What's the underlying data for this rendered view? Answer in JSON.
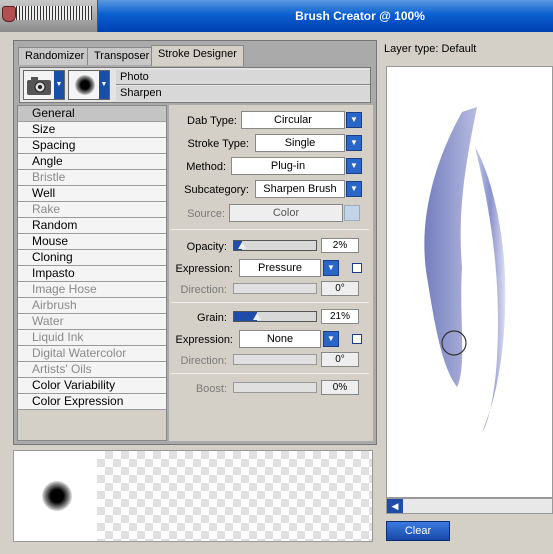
{
  "window": {
    "title": "Brush Creator @ 100%"
  },
  "tabs": [
    {
      "label": "Randomizer"
    },
    {
      "label": "Transposer"
    },
    {
      "label": "Stroke Designer",
      "active": true
    }
  ],
  "brush": {
    "category": "Photo",
    "variant": "Sharpen"
  },
  "categories": [
    {
      "label": "General",
      "selected": true,
      "enabled": true
    },
    {
      "label": "Size",
      "enabled": true
    },
    {
      "label": "Spacing",
      "enabled": true
    },
    {
      "label": "Angle",
      "enabled": true
    },
    {
      "label": "Bristle",
      "enabled": false
    },
    {
      "label": "Well",
      "enabled": true
    },
    {
      "label": "Rake",
      "enabled": false
    },
    {
      "label": "Random",
      "enabled": true
    },
    {
      "label": "Mouse",
      "enabled": true
    },
    {
      "label": "Cloning",
      "enabled": true
    },
    {
      "label": "Impasto",
      "enabled": true
    },
    {
      "label": "Image Hose",
      "enabled": false
    },
    {
      "label": "Airbrush",
      "enabled": false
    },
    {
      "label": "Water",
      "enabled": false
    },
    {
      "label": "Liquid Ink",
      "enabled": false
    },
    {
      "label": "Digital Watercolor",
      "enabled": false
    },
    {
      "label": "Artists' Oils",
      "enabled": false
    },
    {
      "label": "Color Variability",
      "enabled": true
    },
    {
      "label": "Color Expression",
      "enabled": true
    }
  ],
  "general": {
    "dab_type_label": "Dab Type:",
    "dab_type": "Circular",
    "stroke_type_label": "Stroke Type:",
    "stroke_type": "Single",
    "method_label": "Method:",
    "method": "Plug-in",
    "subcategory_label": "Subcategory:",
    "subcategory": "Sharpen Brush",
    "source_label": "Source:",
    "source": "Color",
    "opacity_label": "Opacity:",
    "opacity_value": "2%",
    "opacity_fraction": 0.02,
    "opacity_expression_label": "Expression:",
    "opacity_expression": "Pressure",
    "opacity_direction_label": "Direction:",
    "opacity_direction": "0°",
    "grain_label": "Grain:",
    "grain_value": "21%",
    "grain_fraction": 0.21,
    "grain_expression_label": "Expression:",
    "grain_expression": "None",
    "grain_direction_label": "Direction:",
    "grain_direction": "0°",
    "boost_label": "Boost:",
    "boost_value": "0%"
  },
  "right": {
    "layer_type": "Layer type: Default",
    "clear_label": "Clear"
  },
  "icons": {
    "camera": "camera-icon",
    "dab": "dab-icon",
    "dropdown": "chevron-down-icon",
    "scroll_left": "chevron-left-icon"
  },
  "colors": {
    "title_bar": "#0a5fd0",
    "accent": "#1f4ca8",
    "stroke": "#7b86c4"
  }
}
